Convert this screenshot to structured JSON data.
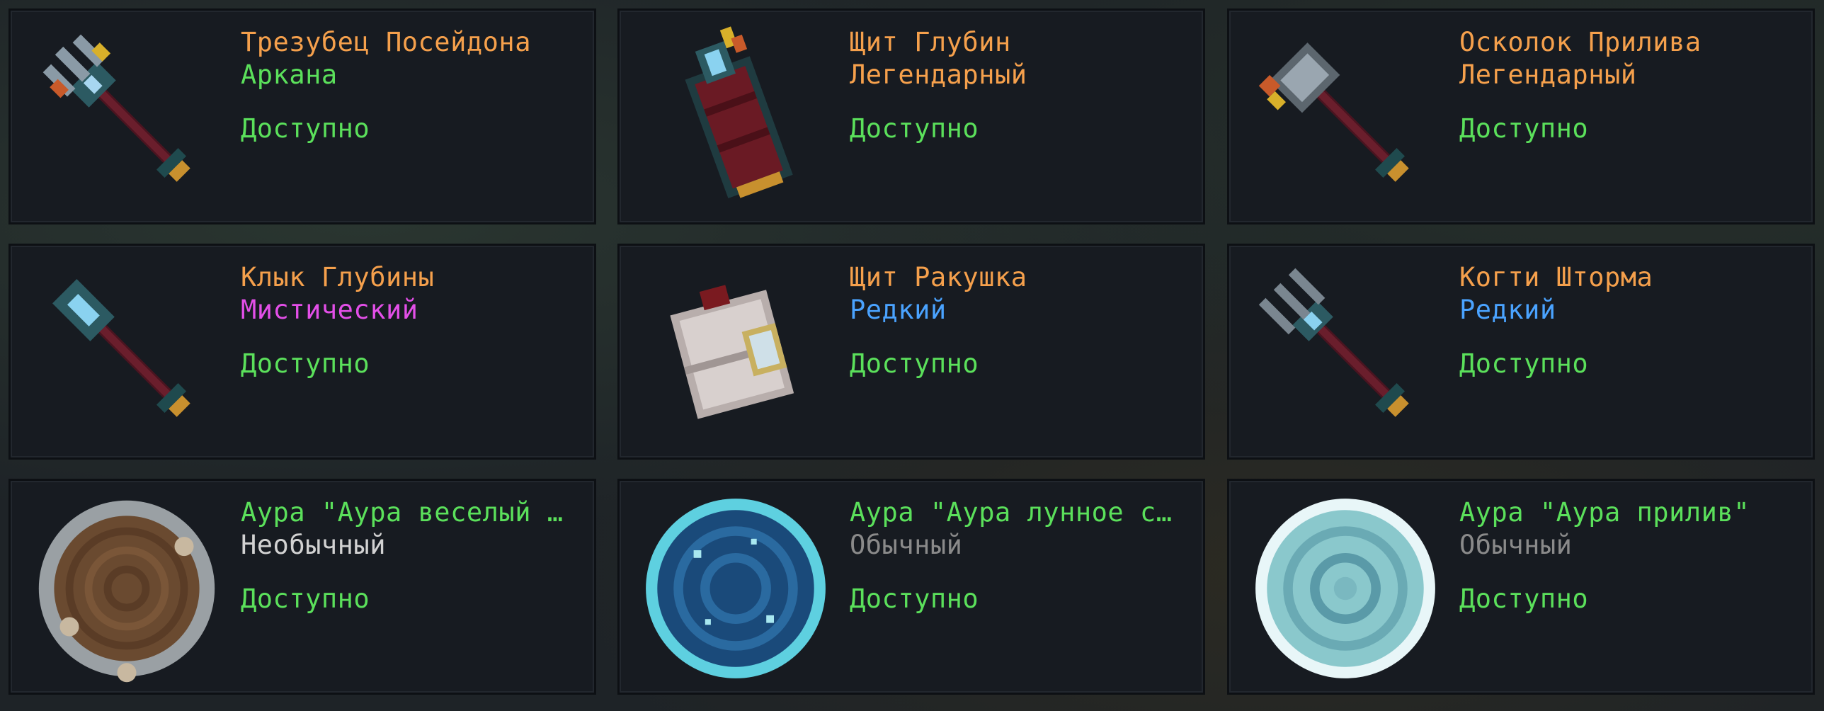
{
  "items": [
    {
      "name": "Трезубец Посейдона",
      "rarity": "Аркана",
      "status": "Доступно",
      "name_color": "#f5a04c",
      "rarity_color": "#5be05b",
      "icon": "trident-icon"
    },
    {
      "name": "Щит Глубин",
      "rarity": "Легендарный",
      "status": "Доступно",
      "name_color": "#f5a04c",
      "rarity_color": "#f5a04c",
      "icon": "shield-icon"
    },
    {
      "name": "Осколок Прилива",
      "rarity": "Легендарный",
      "status": "Доступно",
      "name_color": "#f5a04c",
      "rarity_color": "#f5a04c",
      "icon": "hammer-icon"
    },
    {
      "name": "Клык Глубины",
      "rarity": "Мистический",
      "status": "Доступно",
      "name_color": "#f5a04c",
      "rarity_color": "#e34fe8",
      "icon": "spear-icon"
    },
    {
      "name": "Щит Ракушка",
      "rarity": "Редкий",
      "status": "Доступно",
      "name_color": "#f5a04c",
      "rarity_color": "#4aa3ff",
      "icon": "shell-shield-icon"
    },
    {
      "name": "Когти Шторма",
      "rarity": "Редкий",
      "status": "Доступно",
      "name_color": "#f5a04c",
      "rarity_color": "#4aa3ff",
      "icon": "claw-trident-icon"
    },
    {
      "name": "Аура \"Аура веселый …",
      "rarity": "Необычный",
      "status": "Доступно",
      "name_color": "#5be05b",
      "rarity_color": "#d2d2d2",
      "icon": "aura-stone-icon"
    },
    {
      "name": "Аура \"Аура лунное с…",
      "rarity": "Обычный",
      "status": "Доступно",
      "name_color": "#5be05b",
      "rarity_color": "#8a8a8a",
      "icon": "aura-moon-icon"
    },
    {
      "name": "Аура \"Аура прилив\"",
      "rarity": "Обычный",
      "status": "Доступно",
      "name_color": "#5be05b",
      "rarity_color": "#8a8a8a",
      "icon": "aura-tide-icon"
    }
  ]
}
